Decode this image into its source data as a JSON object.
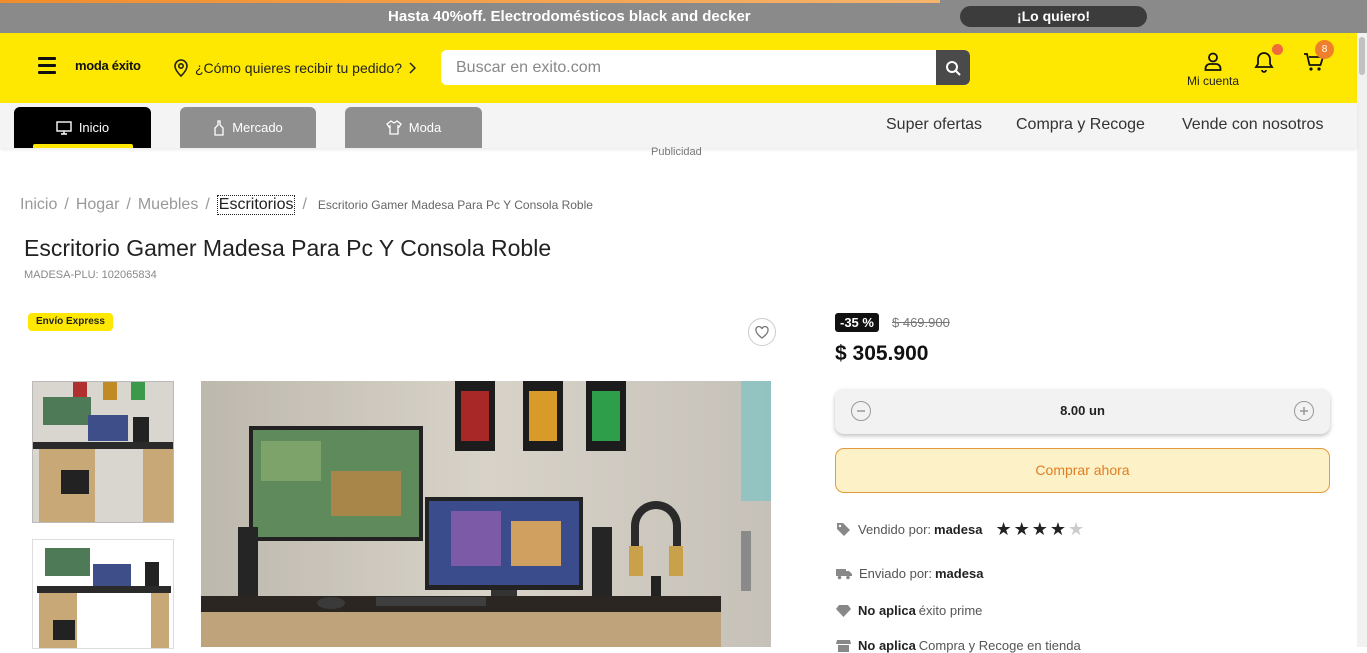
{
  "promo": {
    "text": "Hasta 40%off. Electrodomésticos black and decker",
    "cta": "¡Lo quiero!"
  },
  "header": {
    "logo": "moda éxito",
    "delivery_prompt": "¿Cómo quieres recibir tu pedido?",
    "search_placeholder": "Buscar en exito.com",
    "account_label": "Mi cuenta",
    "cart_count": "8"
  },
  "tabs": [
    {
      "label": "Inicio",
      "icon": "monitor-icon",
      "active": true
    },
    {
      "label": "Mercado",
      "icon": "bottle-icon",
      "active": false
    },
    {
      "label": "Moda",
      "icon": "shirt-icon",
      "active": false
    }
  ],
  "top_links": [
    "Super ofertas",
    "Compra y Recoge",
    "Vende con nosotros"
  ],
  "publicidad": "Publicidad",
  "breadcrumb": {
    "items": [
      "Inicio",
      "Hogar",
      "Muebles",
      "Escritorios"
    ],
    "current": "Escritorio Gamer Madesa Para Pc Y Consola Roble"
  },
  "product": {
    "title": "Escritorio Gamer Madesa Para Pc Y Consola Roble",
    "sku": "MADESA-PLU: 102065834",
    "badge": "Envío Express",
    "discount": "-35 %",
    "old_price": "$ 469.900",
    "price": "$ 305.900",
    "quantity": "8.00 un",
    "buy_label": "Comprar ahora",
    "sold_by_label": "Vendido por:",
    "sold_by": "madesa",
    "rating": 4,
    "rating_max": 5,
    "shipped_by_label": "Enviado por:",
    "shipped_by": "madesa",
    "prime_status": "No aplica",
    "prime_label": "éxito prime",
    "pickup_status": "No aplica",
    "pickup_label": "Compra y Recoge en tienda"
  },
  "colors": {
    "brand_yellow": "#fee801",
    "accent_orange": "#e07e23",
    "promo_gray": "#8a8a8a"
  }
}
